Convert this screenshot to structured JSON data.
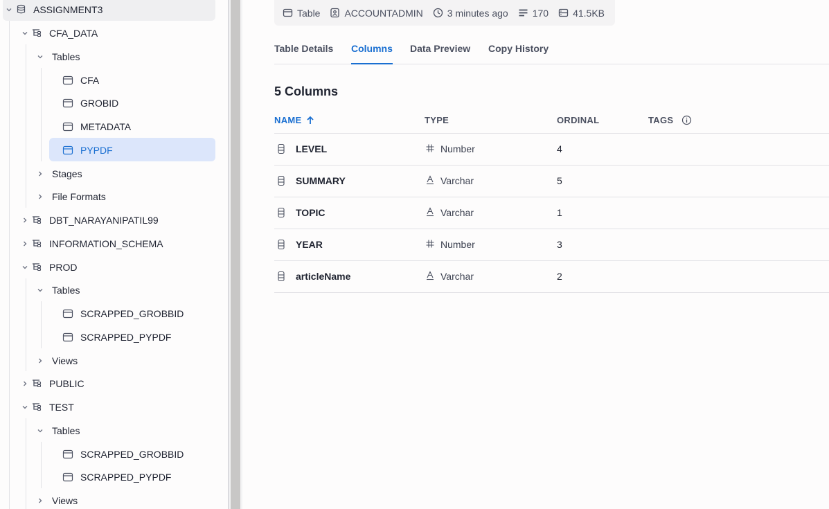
{
  "sidebar": {
    "items": [
      {
        "label": "ASSIGNMENT3",
        "kind": "database",
        "expanded": true,
        "chev": "down"
      },
      {
        "label": "CFA_DATA",
        "kind": "schema",
        "expanded": true,
        "chev": "down"
      },
      {
        "label": "Tables",
        "kind": "folder",
        "chev": "down"
      },
      {
        "label": "CFA",
        "kind": "table"
      },
      {
        "label": "GROBID",
        "kind": "table"
      },
      {
        "label": "METADATA",
        "kind": "table"
      },
      {
        "label": "PYPDF",
        "kind": "table",
        "selected": true
      },
      {
        "label": "Stages",
        "kind": "folder",
        "chev": "right"
      },
      {
        "label": "File Formats",
        "kind": "folder",
        "chev": "right"
      },
      {
        "label": "DBT_NARAYANIPATIL99",
        "kind": "schema",
        "chev": "right"
      },
      {
        "label": "INFORMATION_SCHEMA",
        "kind": "schema",
        "chev": "right"
      },
      {
        "label": "PROD",
        "kind": "schema",
        "chev": "down"
      },
      {
        "label": "Tables",
        "kind": "folder",
        "chev": "down"
      },
      {
        "label": "SCRAPPED_GROBBID",
        "kind": "table"
      },
      {
        "label": "SCRAPPED_PYPDF",
        "kind": "table"
      },
      {
        "label": "Views",
        "kind": "folder",
        "chev": "right"
      },
      {
        "label": "PUBLIC",
        "kind": "schema",
        "chev": "right"
      },
      {
        "label": "TEST",
        "kind": "schema",
        "chev": "down"
      },
      {
        "label": "Tables",
        "kind": "folder",
        "chev": "down"
      },
      {
        "label": "SCRAPPED_GROBBID",
        "kind": "table"
      },
      {
        "label": "SCRAPPED_PYPDF",
        "kind": "table"
      },
      {
        "label": "Views",
        "kind": "folder",
        "chev": "right"
      }
    ]
  },
  "meta": {
    "type": "Table",
    "owner": "ACCOUNTADMIN",
    "updated": "3 minutes ago",
    "rows": "170",
    "size": "41.5KB"
  },
  "tabs": [
    {
      "label": "Table Details",
      "active": false
    },
    {
      "label": "Columns",
      "active": true
    },
    {
      "label": "Data Preview",
      "active": false
    },
    {
      "label": "Copy History",
      "active": false
    }
  ],
  "columns_title": "5 Columns",
  "table": {
    "headers": {
      "name": "NAME",
      "type": "TYPE",
      "ordinal": "ORDINAL",
      "tags": "TAGS"
    },
    "rows": [
      {
        "name": "LEVEL",
        "type": "Number",
        "type_icon": "hash-icon",
        "ordinal": "4"
      },
      {
        "name": "SUMMARY",
        "type": "Varchar",
        "type_icon": "text-type-icon",
        "ordinal": "5"
      },
      {
        "name": "TOPIC",
        "type": "Varchar",
        "type_icon": "text-type-icon",
        "ordinal": "1"
      },
      {
        "name": "YEAR",
        "type": "Number",
        "type_icon": "hash-icon",
        "ordinal": "3"
      },
      {
        "name": "articleName",
        "type": "Varchar",
        "type_icon": "text-type-icon",
        "ordinal": "2"
      }
    ]
  },
  "colors": {
    "accent": "#1a6fd1",
    "selected_bg": "#dce6fb"
  }
}
